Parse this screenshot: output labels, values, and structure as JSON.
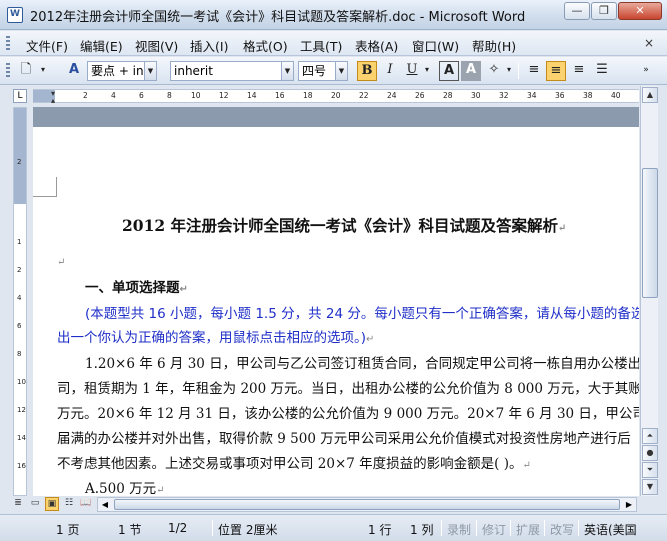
{
  "window": {
    "title": "2012年注册会计师全国统一考试《会计》科目试题及答案解析.doc - Microsoft Word",
    "app_icon": "W",
    "minimize_icon": "minimize-icon",
    "restore_icon": "restore-icon",
    "close_icon": "close-icon"
  },
  "menu": {
    "items": [
      "文件(F)",
      "编辑(E)",
      "视图(V)",
      "插入(I)",
      "格式(O)",
      "工具(T)",
      "表格(A)",
      "窗口(W)",
      "帮助(H)"
    ],
    "close_doc": "×"
  },
  "toolbar": {
    "style_value": "要点 + inhe",
    "font_value": "inherit",
    "size_value": "四号",
    "bold_label": "B",
    "italic_label": "I",
    "underline_label": "U",
    "char_border_label": "A",
    "char_shading_label": "A"
  },
  "ruler": {
    "tab_selector": "L",
    "h_ticks": [
      "2",
      "4",
      "6",
      "8",
      "10",
      "12",
      "14",
      "16",
      "18",
      "20",
      "22",
      "24",
      "26",
      "28",
      "30",
      "32",
      "34",
      "36",
      "38",
      "40"
    ],
    "v_ticks": [
      "2",
      "1",
      "2",
      "4",
      "6",
      "8",
      "10",
      "12",
      "14",
      "16"
    ]
  },
  "document": {
    "title": "2012 年注册会计师全国统一考试《会计》科目试题及答案解析",
    "section_heading": "一、单项选择题",
    "instruction_line1": "(本题型共 16 小题，每小题 1.5 分，共 24 分。每小题只有一个正确答案，请从每小题的备选",
    "instruction_line2": "出一个你认为正确的答案，用鼠标点击相应的选项。)",
    "q1_line1": "1.20×6 年 6 月 30 日，甲公司与乙公司签订租赁合同，合同规定甲公司将一栋自用办公楼出",
    "q1_line2": "司，租赁期为 1 年，年租金为 200 万元。当日，出租办公楼的公允价值为 8 000 万元，大于其账面",
    "q1_line3": "万元。20×6 年 12 月 31 日，该办公楼的公允价值为 9 000 万元。20×7 年 6 月 30 日，甲公司收",
    "q1_line4": "届满的办公楼并对外出售，取得价款 9 500 万元甲公司采用公允价值模式对投资性房地产进行后",
    "q1_line5": "不考虑其他因素。上述交易或事项对甲公司 20×7 年度损益的影响金额是(     )。",
    "option_a": "A.500 万元",
    "paragraph_mark": "↵"
  },
  "status": {
    "page": "1 页",
    "section": "1 节",
    "page_of": "1/2",
    "position": "位置 2厘米",
    "line": "1 行",
    "column": "1 列",
    "rec": "录制",
    "trk": "修订",
    "ext": "扩展",
    "ovr": "改写",
    "language": "英语(美国"
  }
}
